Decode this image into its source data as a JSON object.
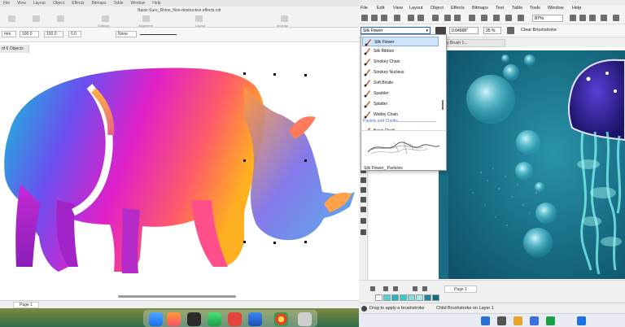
{
  "left_app": {
    "menu": [
      "File",
      "View",
      "Layout",
      "Object",
      "Effects",
      "Bitmaps",
      "Table",
      "Window",
      "Help"
    ],
    "title": "Basic-Sure_Rhino_Non-destructive effects.cdr",
    "toolbar_labels": [
      "Settings",
      "Publish",
      "Alignment",
      "Layout",
      "Arrange"
    ],
    "prop_values": {
      "x": "100.0",
      "y": "100.0",
      "x_unit": "mm",
      "angle": "0.0",
      "outline": "None"
    },
    "objects_tab": "of 6 Objects",
    "page_tab": "Page 1"
  },
  "right_app": {
    "menu": [
      "File",
      "Edit",
      "View",
      "Layout",
      "Object",
      "Effects",
      "Bitmaps",
      "Text",
      "Table",
      "Tools",
      "Window",
      "Help"
    ],
    "zoom": "87%",
    "brush_selected": "Silk Flower",
    "size_value": "0.04568\"",
    "opacity_value": "35 %",
    "clear_label": "Clear Brushstroke",
    "doc_tab": "ly Brush 1...",
    "page_tab": "Page 1",
    "status_hint": "Drag to apply a brushstroke",
    "status_object": "Child Brushstroke on Layer 1",
    "brush_items": [
      "Silk Flower",
      "Silk Ribbon",
      "Smokey Chain",
      "Smokey Nucleus",
      "Soft Bristle",
      "Sparkler",
      "Splatter",
      "Webby Chain"
    ],
    "category": "Pastels and Chalks",
    "category_item": "Basic Chalk",
    "preview_label": "Silk Flower_ Particles",
    "swatches": [
      "#ffffff",
      "#4fd4dc",
      "#1eb3c9",
      "#2ad2cf",
      "#7ee0e6",
      "#a9ecf0",
      "#148aa0",
      "#0c6d84"
    ]
  },
  "colors": {
    "sea": "#176c84",
    "accent_select": "#cfe3fb"
  }
}
